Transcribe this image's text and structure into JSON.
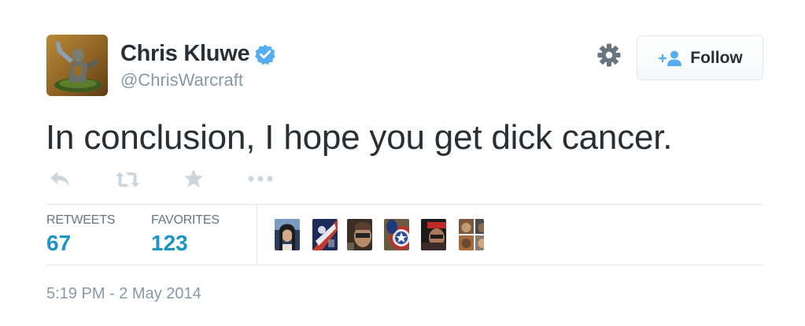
{
  "user": {
    "name": "Chris Kluwe",
    "handle": "@ChrisWarcraft",
    "verified": true
  },
  "follow_button": {
    "label": "Follow",
    "icon": "add-user-icon"
  },
  "settings": {
    "icon": "gear-icon"
  },
  "tweet": {
    "text": "In conclusion, I hope you get dick cancer."
  },
  "actions": [
    {
      "name": "reply",
      "icon": "reply-icon"
    },
    {
      "name": "retweet",
      "icon": "retweet-icon"
    },
    {
      "name": "favorite",
      "icon": "star-icon"
    },
    {
      "name": "more",
      "icon": "ellipsis-icon"
    }
  ],
  "stats": {
    "retweets_label": "RETWEETS",
    "retweets_value": "67",
    "favorites_label": "FAVORITES",
    "favorites_value": "123"
  },
  "favorited_by_count": 6,
  "timestamp": "5:19 PM - 2 May 2014",
  "colors": {
    "text": "#292f33",
    "muted": "#8899a6",
    "accent": "#1b95c4",
    "verified": "#55acee",
    "icon": "#ccd6dd",
    "border": "#e1e8ed"
  }
}
